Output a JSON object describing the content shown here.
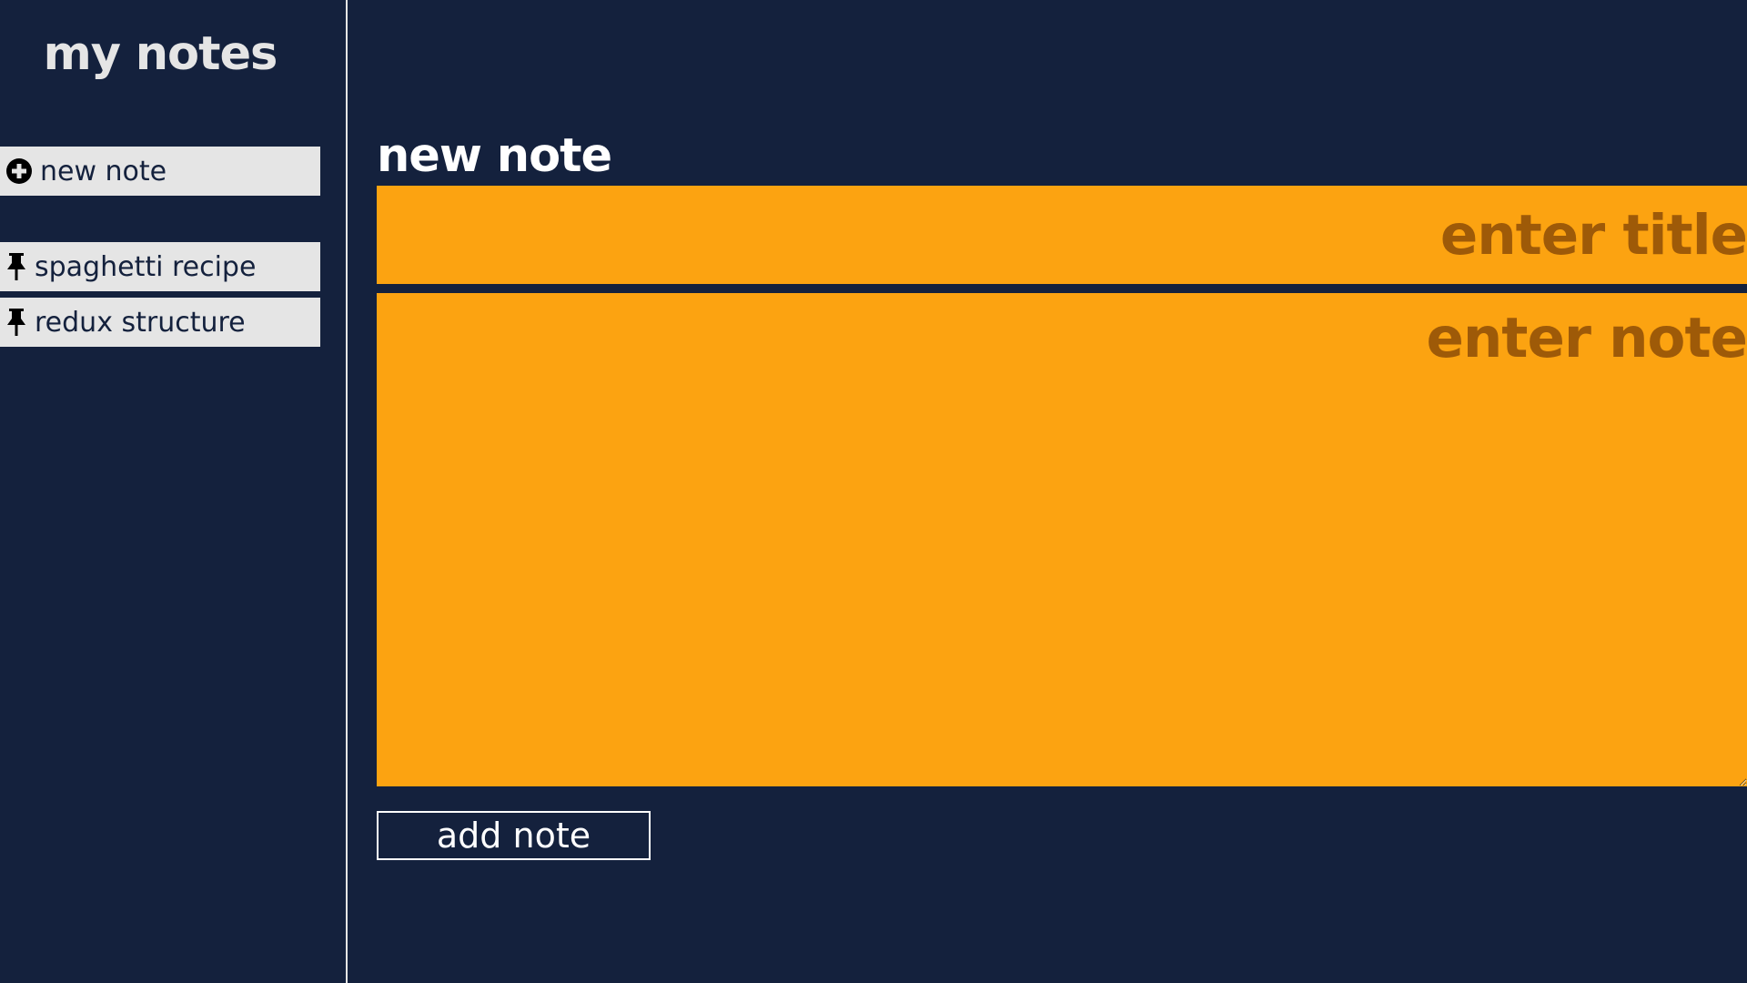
{
  "sidebar": {
    "title": "my notes",
    "new_note": {
      "label": "new note",
      "icon": "plus-circle-icon"
    },
    "notes": [
      {
        "label": "spaghetti recipe",
        "icon": "pin-icon"
      },
      {
        "label": "redux structure",
        "icon": "pin-icon"
      }
    ]
  },
  "main": {
    "heading": "new note",
    "title_placeholder": "enter title",
    "title_value": "",
    "note_placeholder": "enter note",
    "note_value": "",
    "add_button_label": "add note"
  },
  "colors": {
    "background": "#14213d",
    "accent": "#fca311",
    "placeholder": "#9e5a08",
    "sidebar_item": "#e5e5e5",
    "text_light": "#ffffff"
  }
}
